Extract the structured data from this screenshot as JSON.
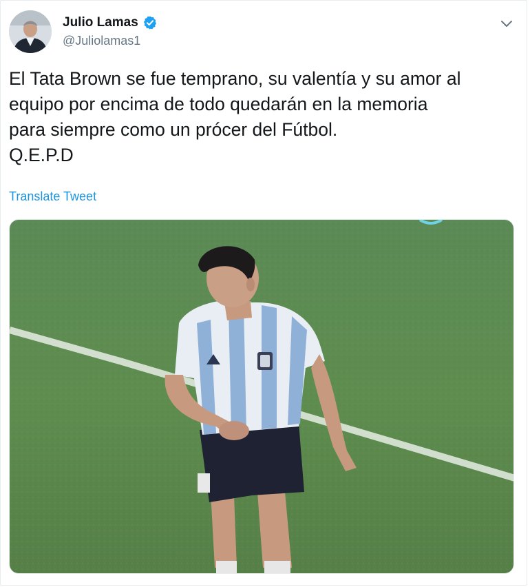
{
  "tweet": {
    "author": {
      "display_name": "Julio Lamas",
      "handle": "@Juliolamas1",
      "verified": true,
      "avatar_icon": "profile-photo"
    },
    "menu_icon": "chevron-down-icon",
    "text": "El Tata Brown se fue temprano, su valentía y su amor al\nequipo por encima de todo quedarán en la memoria\npara siempre como un prócer del Fútbol.\nQ.E.P.D",
    "translate_label": "Translate Tweet",
    "media": {
      "type": "image",
      "subject": "soccer player in striped jersey on grass field"
    }
  },
  "colors": {
    "text": "#14171a",
    "secondary": "#657786",
    "link": "#1b95e0",
    "verified": "#1da1f2",
    "grass": "#5f8b52"
  }
}
